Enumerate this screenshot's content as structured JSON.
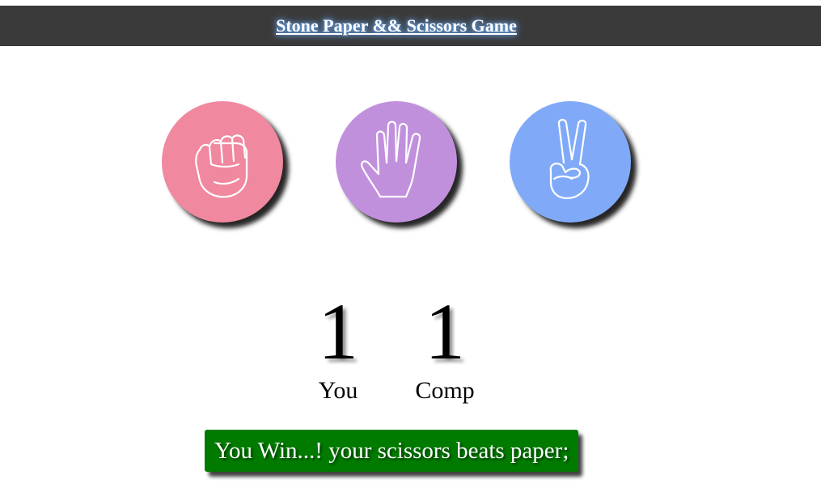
{
  "header": {
    "title": "Stone Paper && Scissors Game",
    "background": "#3b3a3a"
  },
  "choices": [
    {
      "name": "stone",
      "icon": "fist-icon",
      "color": "#f0889f"
    },
    {
      "name": "paper",
      "icon": "open-hand-icon",
      "color": "#c190dd"
    },
    {
      "name": "scissors",
      "icon": "peace-hand-icon",
      "color": "#80aaf8"
    }
  ],
  "scoreboard": {
    "user_score": "1",
    "user_label": "You",
    "comp_score": "1",
    "comp_label": "Comp"
  },
  "message": {
    "text": "You Win...! your scissors beats paper;",
    "color": "#007b00"
  }
}
